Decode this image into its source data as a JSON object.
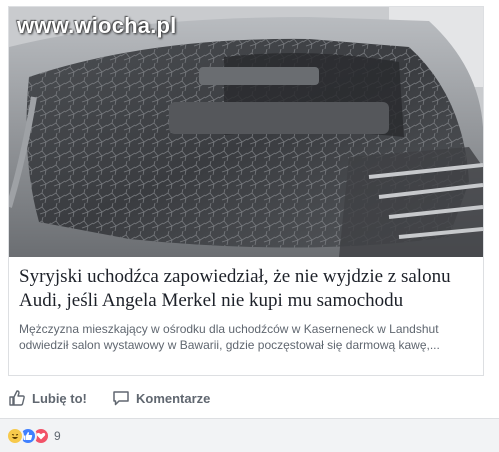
{
  "post": {
    "image": {
      "watermark": "www.wiocha.pl",
      "subject": "car-rear-window-shattered"
    },
    "link": {
      "title": "Syryjski uchodźca zapowiedział, że nie wyjdzie z salonu Audi, jeśli Angela Merkel nie kupi mu samochodu",
      "description": "Mężczyzna mieszkający w ośrodku dla uchodźców w Kaserneneck w Landshut odwiedził salon wystawowy w Bawarii, gdzie poczęstował się darmową kawę,..."
    },
    "actions": {
      "like_label": "Lubię to!",
      "comment_label": "Komentarze",
      "like_icon": "thumbs-up-icon",
      "comment_icon": "speech-bubble-icon"
    },
    "reactions": {
      "types": [
        "haha",
        "like",
        "love"
      ],
      "count": "9"
    }
  },
  "colors": {
    "text": "#1d2129",
    "secondary_text": "#606770",
    "border": "#dddfe2",
    "like_blue": "#4080ff",
    "love_red": "#f25268",
    "haha_yellow": "#f7c94b"
  }
}
